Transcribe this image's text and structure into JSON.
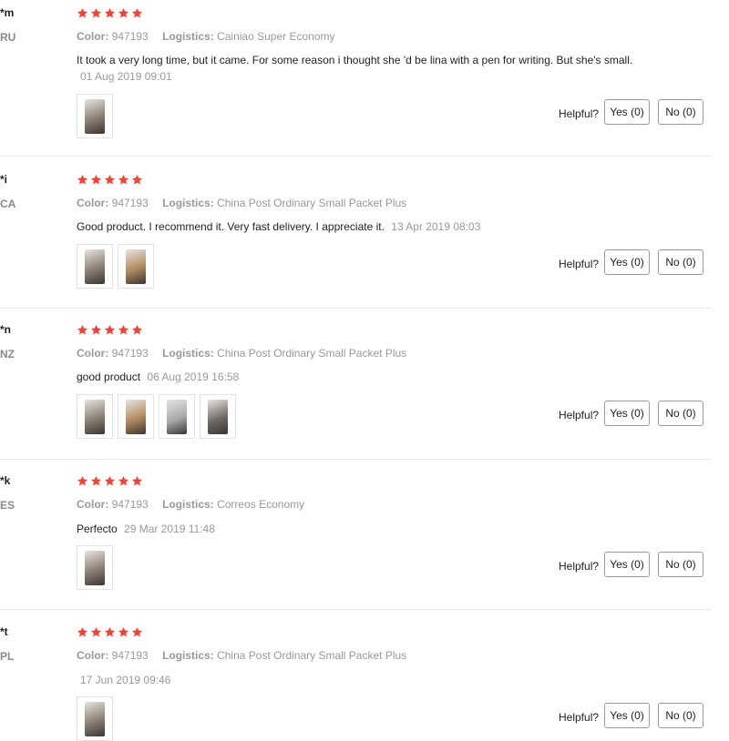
{
  "labels": {
    "color": "Color:",
    "logistics": "Logistics:",
    "helpful": "Helpful?"
  },
  "star_color": "#f44336",
  "reviews": [
    {
      "user": "*m",
      "country": "RU",
      "rating": 5,
      "color_value": "947193",
      "logistics_value": "Cainiao Super Economy",
      "text": "It took a very long time, but it came. For some reason i thought she 'd be lina with a pen for writing. But she's small.",
      "date": "01 Aug 2019 09:01",
      "photos": 1,
      "yes_label": "Yes (0)",
      "no_label": "No (0)"
    },
    {
      "user": "*i",
      "country": "CA",
      "rating": 5,
      "color_value": "947193",
      "logistics_value": "China Post Ordinary Small Packet Plus",
      "text": "Good product. I recommend it. Very fast delivery. I appreciate it.",
      "date": "13 Apr 2019 08:03",
      "photos": 2,
      "yes_label": "Yes (0)",
      "no_label": "No (0)"
    },
    {
      "user": "*n",
      "country": "NZ",
      "rating": 5,
      "color_value": "947193",
      "logistics_value": "China Post Ordinary Small Packet Plus",
      "text": "good product",
      "date": "06 Aug 2019 16:58",
      "photos": 4,
      "yes_label": "Yes (0)",
      "no_label": "No (0)"
    },
    {
      "user": "*k",
      "country": "ES",
      "rating": 5,
      "color_value": "947193",
      "logistics_value": "Correos Economy",
      "text": "Perfecto",
      "date": "29 Mar 2019 11:48",
      "photos": 1,
      "yes_label": "Yes (0)",
      "no_label": "No (0)"
    },
    {
      "user": "*t",
      "country": "PL",
      "rating": 5,
      "color_value": "947193",
      "logistics_value": "China Post Ordinary Small Packet Plus",
      "text": "",
      "date": "17 Jun 2019 09:46",
      "photos": 1,
      "yes_label": "Yes (0)",
      "no_label": "No (0)"
    }
  ]
}
